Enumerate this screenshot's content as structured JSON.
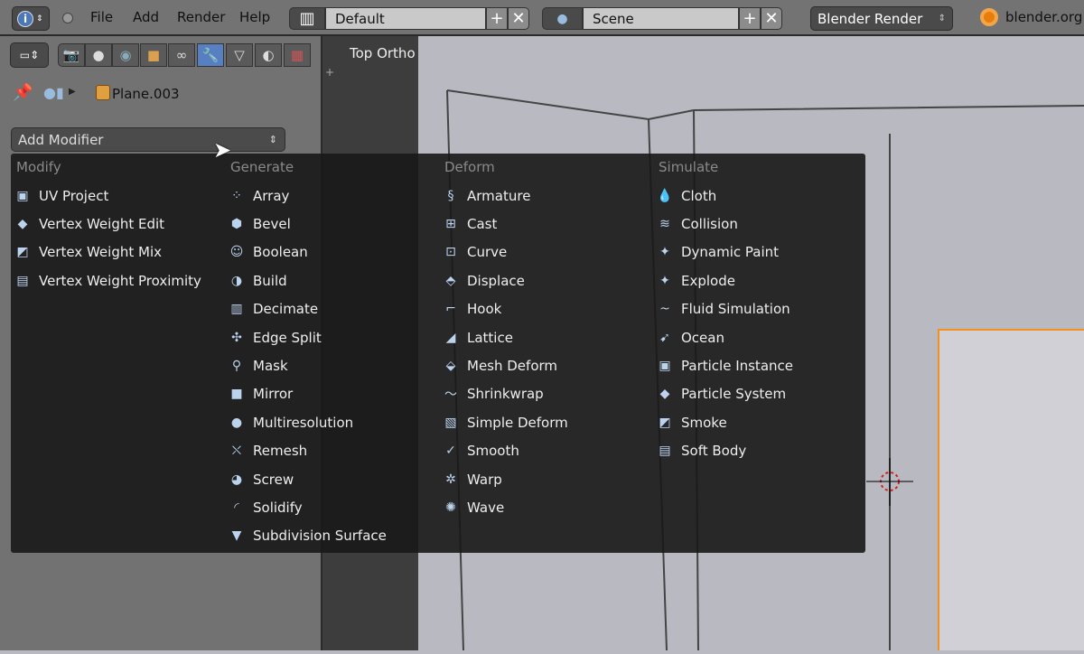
{
  "topbar": {
    "menus": [
      "File",
      "Add",
      "Render",
      "Help"
    ],
    "layout": "Default",
    "scene": "Scene",
    "engine": "Blender Render",
    "site": "blender.org"
  },
  "properties": {
    "breadcrumb_object": "Plane.003",
    "add_modifier": "Add Modifier"
  },
  "viewport": {
    "label": "Top Ortho"
  },
  "modifier_menu": {
    "columns": [
      {
        "header": "Modify",
        "items": [
          "UV Project",
          "Vertex Weight Edit",
          "Vertex Weight Mix",
          "Vertex Weight Proximity"
        ]
      },
      {
        "header": "Generate",
        "items": [
          "Array",
          "Bevel",
          "Boolean",
          "Build",
          "Decimate",
          "Edge Split",
          "Mask",
          "Mirror",
          "Multiresolution",
          "Remesh",
          "Screw",
          "Solidify",
          "Subdivision Surface"
        ]
      },
      {
        "header": "Deform",
        "items": [
          "Armature",
          "Cast",
          "Curve",
          "Displace",
          "Hook",
          "Lattice",
          "Mesh Deform",
          "Shrinkwrap",
          "Simple Deform",
          "Smooth",
          "Warp",
          "Wave"
        ]
      },
      {
        "header": "Simulate",
        "items": [
          "Cloth",
          "Collision",
          "Dynamic Paint",
          "Explode",
          "Fluid Simulation",
          "Ocean",
          "Particle Instance",
          "Particle System",
          "Smoke",
          "Soft Body"
        ]
      }
    ]
  }
}
